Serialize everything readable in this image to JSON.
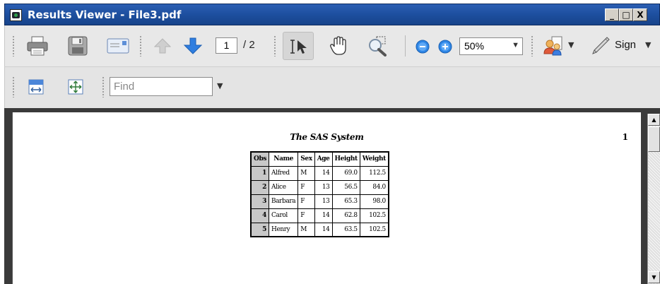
{
  "window": {
    "title": "Results Viewer - File3.pdf",
    "buttons": {
      "minimize": "_",
      "maximize": "□",
      "close": "X"
    }
  },
  "toolbar": {
    "icons": [
      "print-icon",
      "save-icon",
      "email-icon",
      "previous-page-icon",
      "next-page-icon",
      "select-tool-icon",
      "hand-tool-icon",
      "marquee-zoom-icon",
      "zoom-out-icon",
      "zoom-in-icon",
      "collaborate-icon",
      "sign-pen-icon"
    ],
    "current_page": "1",
    "total_pages": "/ 2",
    "zoom": "50%",
    "sign_label": "Sign"
  },
  "toolbar2": {
    "icons": [
      "fit-width-icon",
      "fit-page-icon"
    ],
    "find_placeholder": "Find"
  },
  "document": {
    "title": "The SAS System",
    "page_number": "1",
    "table": {
      "headers": [
        "Obs",
        "Name",
        "Sex",
        "Age",
        "Height",
        "Weight"
      ],
      "rows": [
        [
          "1",
          "Alfred",
          "M",
          "14",
          "69.0",
          "112.5"
        ],
        [
          "2",
          "Alice",
          "F",
          "13",
          "56.5",
          "84.0"
        ],
        [
          "3",
          "Barbara",
          "F",
          "13",
          "65.3",
          "98.0"
        ],
        [
          "4",
          "Carol",
          "F",
          "14",
          "62.8",
          "102.5"
        ],
        [
          "5",
          "Henry",
          "M",
          "14",
          "63.5",
          "102.5"
        ]
      ]
    }
  },
  "colors": {
    "titlebar": "#1d4f9f",
    "toolbar": "#e8e8e8",
    "arrow_blue": "#2f7ee0",
    "obs_shade": "#c8c8c8"
  }
}
